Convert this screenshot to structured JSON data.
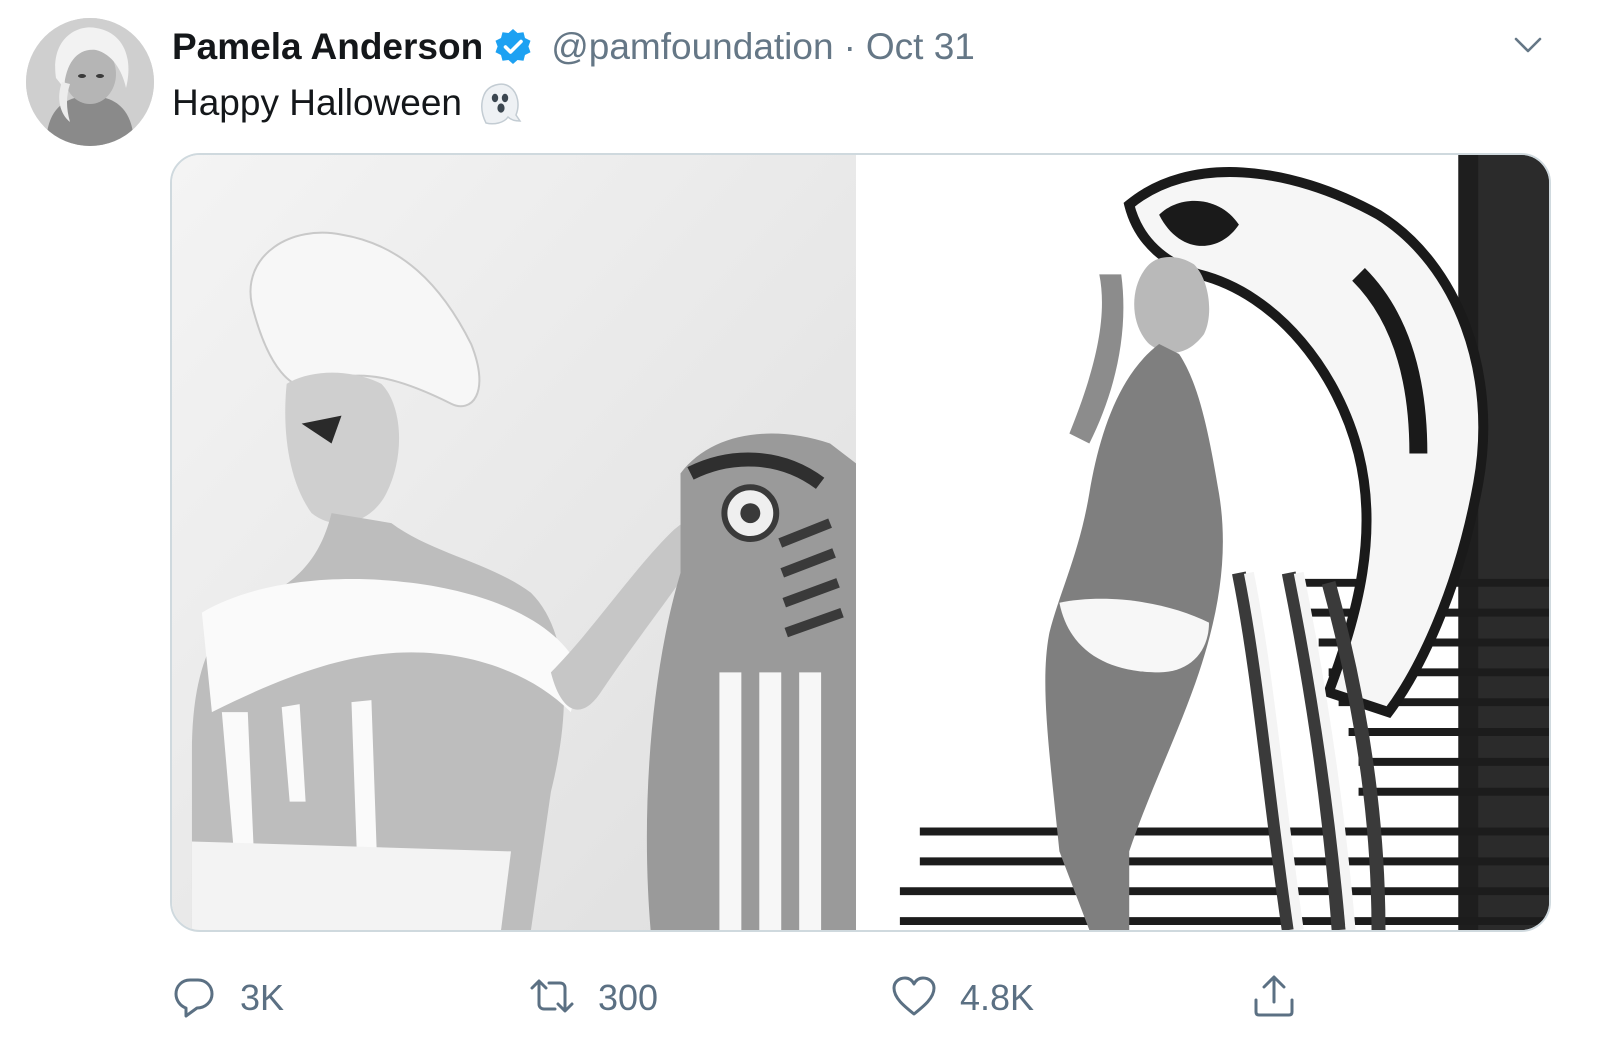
{
  "tweet": {
    "author_name": "Pamela Anderson",
    "handle": "@pamfoundation",
    "separator": "·",
    "date": "Oct 31",
    "text": "Happy Halloween",
    "verified": true
  },
  "icons": {
    "verified": "verified-badge-icon",
    "ghost": "ghost-emoji-icon",
    "more": "chevron-down-icon",
    "reply": "reply-icon",
    "retweet": "retweet-icon",
    "like": "heart-icon",
    "share": "share-icon"
  },
  "actions": {
    "reply_count": "3K",
    "retweet_count": "300",
    "like_count": "4.8K"
  },
  "colors": {
    "verified_blue": "#1da1f2",
    "text_primary": "#14171a",
    "text_secondary": "#657786",
    "icon_gray": "#5b7083",
    "media_border": "#cfd9de"
  }
}
